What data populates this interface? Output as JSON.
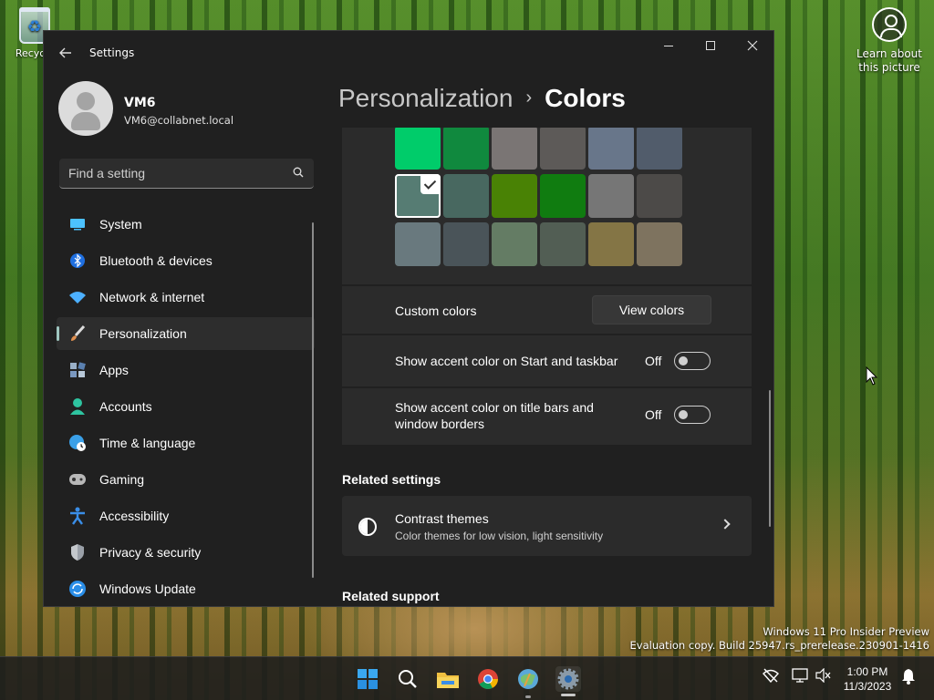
{
  "desktop": {
    "recycle_bin_label": "Recycle",
    "learn_label": "Learn about this picture",
    "watermark_line1": "Windows 11 Pro Insider Preview",
    "watermark_line2": "Evaluation copy. Build 25947.rs_prerelease.230901-1416"
  },
  "window": {
    "title": "Settings",
    "minimize_icon": "minimize-icon",
    "maximize_icon": "maximize-icon",
    "close_icon": "close-icon"
  },
  "profile": {
    "name": "VM6",
    "email": "VM6@collabnet.local"
  },
  "search": {
    "placeholder": "Find a setting"
  },
  "nav": {
    "items": [
      {
        "label": "System",
        "icon": "system-icon",
        "color": "#4cc2ff"
      },
      {
        "label": "Bluetooth & devices",
        "icon": "bluetooth-icon",
        "color": "#1f6fe0"
      },
      {
        "label": "Network & internet",
        "icon": "wifi-icon",
        "color": "#4cb0ff"
      },
      {
        "label": "Personalization",
        "icon": "brush-icon",
        "color": "#e0a060"
      },
      {
        "label": "Apps",
        "icon": "apps-icon",
        "color": "#7aa0c8"
      },
      {
        "label": "Accounts",
        "icon": "accounts-icon",
        "color": "#2ec4a0"
      },
      {
        "label": "Time & language",
        "icon": "globe-clock-icon",
        "color": "#3aa0e8"
      },
      {
        "label": "Gaming",
        "icon": "gamepad-icon",
        "color": "#b8b8b8"
      },
      {
        "label": "Accessibility",
        "icon": "accessibility-icon",
        "color": "#3a8ee8"
      },
      {
        "label": "Privacy & security",
        "icon": "shield-icon",
        "color": "#9aa0a8"
      },
      {
        "label": "Windows Update",
        "icon": "update-icon",
        "color": "#2a8ee8"
      }
    ],
    "active_index": 3
  },
  "breadcrumb": {
    "parent": "Personalization",
    "current": "Colors"
  },
  "palette": {
    "rows": [
      [
        "#00cc6a",
        "#10893e",
        "#7a7574",
        "#5d5a58",
        "#68768a",
        "#515c6b"
      ],
      [
        "#567c73",
        "#486860",
        "#498205",
        "#107c10",
        "#767676",
        "#4c4a48"
      ],
      [
        "#69797e",
        "#4a5459",
        "#647c64",
        "#525e54",
        "#847545",
        "#7e735f"
      ]
    ],
    "selected": {
      "row": 1,
      "col": 0
    }
  },
  "custom_colors": {
    "label": "Custom colors",
    "button": "View colors"
  },
  "accent_start": {
    "label": "Show accent color on Start and taskbar",
    "state": "Off"
  },
  "accent_title": {
    "label_line1": "Show accent color on title bars and",
    "label_line2": "window borders",
    "state": "Off"
  },
  "related_settings": {
    "heading": "Related settings",
    "contrast_title": "Contrast themes",
    "contrast_sub": "Color themes for low vision, light sensitivity"
  },
  "related_support": {
    "heading": "Related support"
  },
  "taskbar": {
    "time": "1:00 PM",
    "date": "11/3/2023",
    "icons": [
      "windows-start-icon",
      "search-icon",
      "file-explorer-icon",
      "chrome-icon",
      "app-icon",
      "settings-icon"
    ]
  }
}
